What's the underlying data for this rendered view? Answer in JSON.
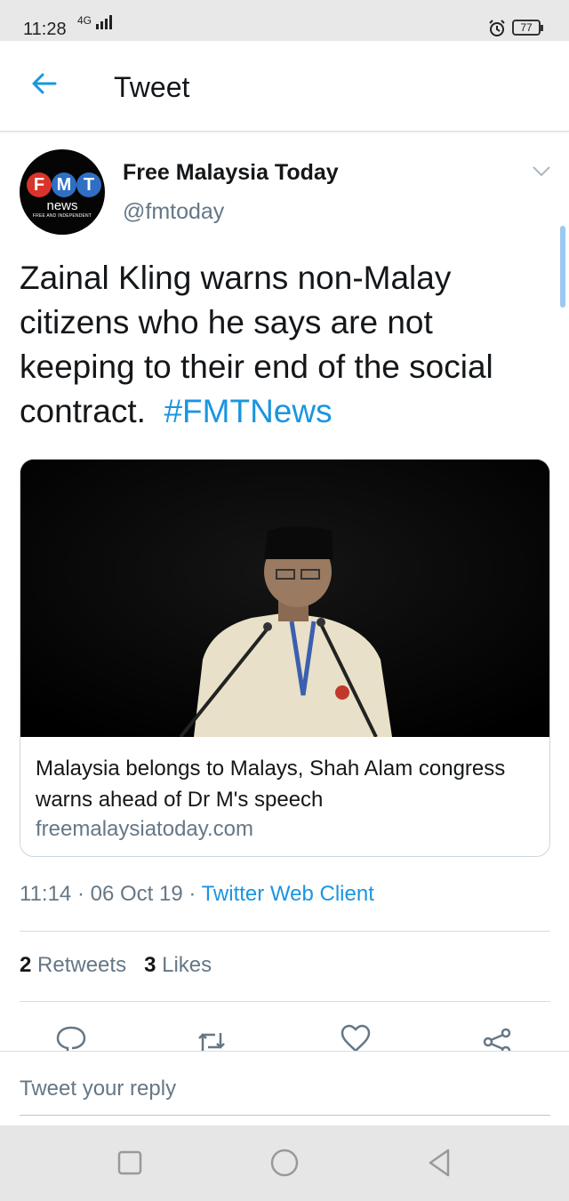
{
  "status_bar": {
    "time": "11:28",
    "network": "4G",
    "battery": "77"
  },
  "header": {
    "back_icon": "arrow-left-icon",
    "title": "Tweet"
  },
  "author": {
    "avatar": {
      "letters": [
        "F",
        "M",
        "T"
      ],
      "colors": [
        "#d9342b",
        "#2f6fc4",
        "#2f6fc4"
      ],
      "word": "news",
      "tagline": "FREE AND INDEPENDENT"
    },
    "name": "Free Malaysia Today",
    "handle": "@fmtoday"
  },
  "tweet": {
    "text": "Zainal Kling warns non-Malay citizens who he says are not keeping to their end of the social contract.",
    "hashtag": "#FMTNews"
  },
  "card": {
    "image": "man speaking at podium",
    "title": "Malaysia belongs to Malays, Shah Alam congress warns ahead of Dr M's speech",
    "domain": "freemalaysiatoday.com"
  },
  "meta": {
    "time": "11:14",
    "sep": " · ",
    "date": "06 Oct 19",
    "source": "Twitter Web Client"
  },
  "stats": {
    "retweets_count": "2",
    "retweets_label": "Retweets",
    "likes_count": "3",
    "likes_label": "Likes"
  },
  "actions": [
    "reply-icon",
    "retweet-icon",
    "like-icon",
    "share-icon"
  ],
  "reply": {
    "placeholder": "Tweet your reply"
  },
  "nav": [
    "recent-apps-icon",
    "home-icon",
    "back-icon"
  ],
  "colors": {
    "link": "#1b95e0",
    "secondary": "#657786"
  }
}
